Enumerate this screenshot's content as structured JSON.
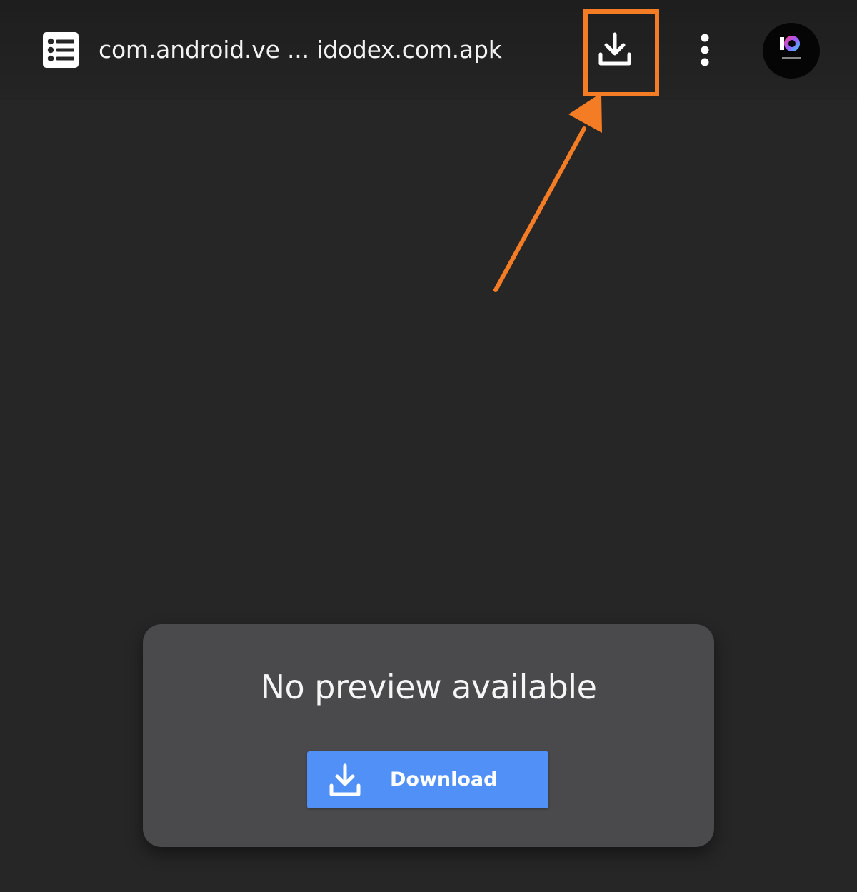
{
  "toolbar": {
    "file_name": "com.android.ve ... idodex.com.apk",
    "icons": {
      "file": "file-list-icon",
      "download": "download-icon",
      "more": "more-vert-icon",
      "avatar": "profile-avatar"
    }
  },
  "annotation": {
    "color": "#f47c24",
    "target": "download-icon"
  },
  "preview": {
    "message": "No preview available",
    "download_label": "Download",
    "button_color": "#5191f7"
  },
  "colors": {
    "background": "#262626",
    "card": "#4a4a4c"
  }
}
